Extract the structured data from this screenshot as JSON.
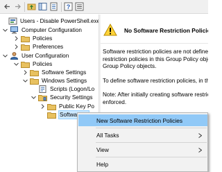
{
  "toolbar": {
    "buttons": [
      "back-icon",
      "forward-icon",
      "up-folder-icon",
      "show-hide-tree-icon",
      "properties-icon",
      "help-icon",
      "list-icon"
    ]
  },
  "tree": {
    "items": [
      {
        "label": "Users - Disable PowerShell.exe [",
        "icon": "gpo-icon"
      },
      {
        "label": "Computer Configuration",
        "icon": "computer-icon"
      },
      {
        "label": "Policies",
        "icon": "folder-icon"
      },
      {
        "label": "Preferences",
        "icon": "folder-icon"
      },
      {
        "label": "User Configuration",
        "icon": "user-icon"
      },
      {
        "label": "Policies",
        "icon": "folder-icon"
      },
      {
        "label": "Software Settings",
        "icon": "folder-icon"
      },
      {
        "label": "Windows Settings",
        "icon": "folder-icon"
      },
      {
        "label": "Scripts (Logon/Lo",
        "icon": "scripts-icon"
      },
      {
        "label": "Security Settings",
        "icon": "security-icon"
      },
      {
        "label": "Public Key Po",
        "icon": "folder-icon"
      },
      {
        "label": "Software R",
        "icon": "folder-icon"
      }
    ]
  },
  "details": {
    "title": "No Software Restriction Policies",
    "para1": [
      "Software restriction policies are not defined",
      "restriction policies in this Group Policy obje",
      "Group Policy objects."
    ],
    "para2": [
      "To define software restriction policies, in th"
    ],
    "para3": [
      "Note: After initially creating software restricti",
      "enforced."
    ]
  },
  "context_menu": {
    "items": [
      {
        "label": "New Software Restriction Policies"
      },
      {
        "label": "All Tasks"
      },
      {
        "label": "View"
      },
      {
        "label": "Help"
      }
    ]
  },
  "colors": {
    "menu_highlight": "#91c9f7",
    "selection": "#cce8ff",
    "folder": "#e8c160"
  }
}
